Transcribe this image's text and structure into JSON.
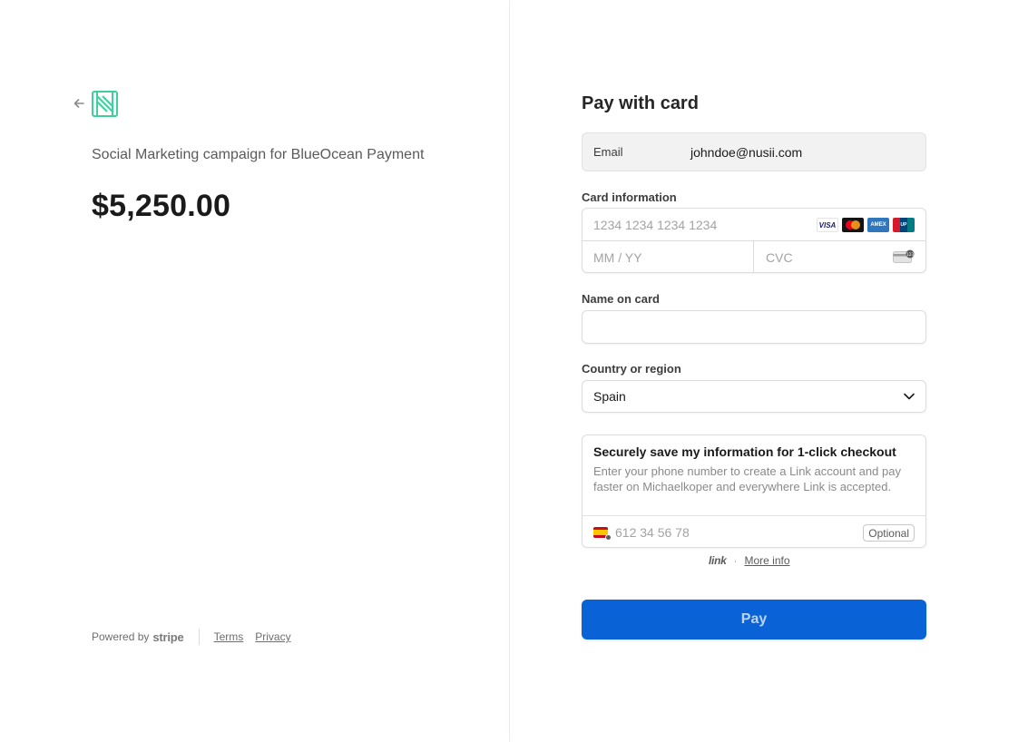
{
  "merchant": {
    "back_icon": "arrow-left-icon",
    "logo_icon": "merchant-logo-icon",
    "brand_color": "#3ecf9b"
  },
  "product": {
    "title": "Social Marketing campaign for BlueOcean Payment",
    "price": "$5,250.00"
  },
  "footer": {
    "powered_by": "Powered by",
    "stripe": "stripe",
    "terms": "Terms",
    "privacy": "Privacy"
  },
  "form": {
    "heading": "Pay with card",
    "email_label": "Email",
    "email_value": "johndoe@nusii.com",
    "card_label": "Card information",
    "card_number_placeholder": "1234 1234 1234 1234",
    "card_brands": [
      "VISA",
      "Mastercard",
      "AMEX",
      "UnionPay"
    ],
    "expiry_placeholder": "MM / YY",
    "cvc_placeholder": "CVC",
    "name_label": "Name on card",
    "name_value": "",
    "country_label": "Country or region",
    "country_value": "Spain"
  },
  "link_save": {
    "title": "Securely save my information for 1-click checkout",
    "description": "Enter your phone number to create a Link account and pay faster on Michaelkoper and everywhere Link is accepted.",
    "phone_placeholder": "612 34 56 78",
    "optional": "Optional",
    "link_logo": "link",
    "more_info": "More info"
  },
  "pay_button": {
    "label": "Pay",
    "color": "#0a63d6"
  }
}
